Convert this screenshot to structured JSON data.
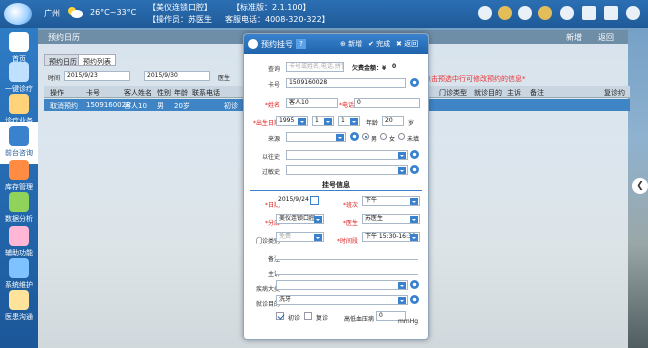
{
  "topbar": {
    "location": "广州",
    "weather": "26°C~33°C",
    "clinic": "【美仪连锁口腔】",
    "version": "【标准版：2.1.100】",
    "operator": "【操作员：苏医生",
    "hotline": "客服电话：4008-320-322】"
  },
  "sidebar": {
    "items": [
      {
        "label": "首页",
        "icon": "home-icon",
        "color": "#ffffff"
      },
      {
        "label": "一键诊疗",
        "icon": "treat-icon",
        "color": "#bfe1ff"
      },
      {
        "label": "诊疗业务",
        "icon": "business-icon",
        "color": "#ffd37a"
      },
      {
        "label": "前台咨询",
        "icon": "frontdesk-icon",
        "color": "#3a82ce"
      },
      {
        "label": "库存管理",
        "icon": "inventory-icon",
        "color": "#ff8c42"
      },
      {
        "label": "数据分析",
        "icon": "analysis-icon",
        "color": "#8fd35b"
      },
      {
        "label": "辅助功能",
        "icon": "assist-icon",
        "color": "#ffb7d5"
      },
      {
        "label": "系统维护",
        "icon": "maintenance-icon",
        "color": "#7ec2ff"
      },
      {
        "label": "医患沟通",
        "icon": "communication-icon",
        "color": "#ffe39a"
      }
    ]
  },
  "background": {
    "title": "预约日历",
    "add_label": "新增",
    "return_label": "返回",
    "tabs": [
      "预约日历",
      "预约列表"
    ],
    "time_label": "时间",
    "date_from": "2015/9/23",
    "date_to": "2015/9/30",
    "doctor_label": "医生",
    "hint": "点击预选中行可修改预约的信息*",
    "columns": [
      "操作",
      "卡号",
      "客人姓名",
      "性别",
      "年龄",
      "联系电话",
      "门诊类型",
      "就诊目的",
      "主诉",
      "备注",
      "复诊约"
    ],
    "row": [
      "取消预约",
      "1509160028",
      "客人10",
      "男",
      "20岁",
      "",
      "初诊",
      "",
      "",
      "",
      ""
    ]
  },
  "modal": {
    "title": "预约挂号",
    "add": "新增",
    "done": "完成",
    "back": "返回",
    "query_label": "查询",
    "query_placeholder": "卡号或姓名,电话,拼音五笔码",
    "balance_label": "欠费金额：¥",
    "balance_value": "0",
    "card_label": "卡号",
    "card_value": "1509160028",
    "name_label": "*姓名",
    "name_value": "客人10",
    "phone_label": "*电话",
    "phone_value": "0",
    "birth_label": "*出生日期",
    "birth_year": "1995",
    "birth_month": "1",
    "birth_day": "1",
    "age_label": "年龄",
    "age_value": "20",
    "age_unit": "岁",
    "source_label": "来源",
    "gender_male": "男",
    "gender_female": "女",
    "gender_unknown": "未填",
    "history_label": "以往史",
    "allergy_label": "过敏史",
    "section": "挂号信息",
    "date_label": "*日期",
    "date_value": "2015/9/24",
    "shift_label": "*班次",
    "shift_value": "下午",
    "branch_label": "*分店",
    "branch_value": "美仪连锁口腔",
    "doctor_label": "*医生",
    "doctor_value": "苏医生",
    "type_label": "门诊类别",
    "type_value": "免费",
    "time_label": "*时间段",
    "time_value": "下午 15:30-16:30",
    "note_label": "备注",
    "complaint_label": "主诉",
    "disease_label": "疾病大类",
    "purpose_label": "就诊目的",
    "purpose_value": "洗牙",
    "first_visit": "初诊",
    "revisit": "复诊",
    "bp_label": "高低血压病",
    "bp_value": "0",
    "bp_unit": "mmHg"
  }
}
